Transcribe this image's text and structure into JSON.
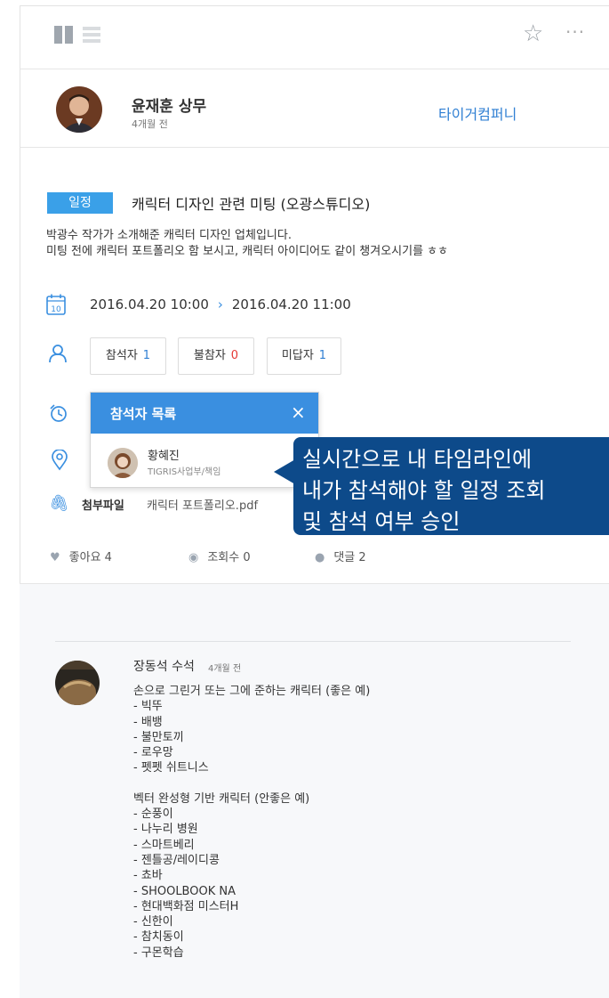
{
  "header": {
    "star_icon": "star-outline-icon",
    "more_icon": "more-horizontal-icon",
    "more_label": "···"
  },
  "author": {
    "name": "윤재훈 상무",
    "time": "4개월 전",
    "company": "타이거컴퍼니"
  },
  "event": {
    "badge": "일정",
    "title": "캐릭터 디자인 관련 미팅 (오광스튜디오)",
    "desc": [
      "박광수 작가가 소개해준 캐릭터 디자인 업체입니다.",
      "미팅 전에 캐릭터 포트폴리오 함 보시고, 캐릭터 아이디어도 같이 챙겨오시기를 ㅎㅎ"
    ],
    "calendar_day": "10",
    "start": "2016.04.20 10:00",
    "arrow": "›",
    "end": "2016.04.20 11:00"
  },
  "attendance": [
    {
      "label": "참석자",
      "count": "1",
      "color": "#2f7fd3"
    },
    {
      "label": "불참자",
      "count": "0",
      "color": "#e53935"
    },
    {
      "label": "미답자",
      "count": "1",
      "color": "#2f7fd3"
    }
  ],
  "popup": {
    "title": "참석자 목록",
    "close": "×",
    "person_name": "황혜진",
    "person_dept": "TIGRIS사업부/책임"
  },
  "callout": {
    "lines": [
      "실시간으로 내 타임라인에",
      "내가 참석해야 할 일정 조회",
      "및 참석 여부 승인"
    ]
  },
  "attachment": {
    "label": "첨부파일",
    "file": "캐릭터 포트폴리오.pdf"
  },
  "stats": {
    "likes": "좋아요 4",
    "views": "조회수 0",
    "comments": "댓글 2"
  },
  "comment": {
    "name": "장동석 수석",
    "time": "4개월 전",
    "block1": [
      "손으로 그린거 또는 그에 준하는 캐릭터 (좋은 예)",
      "- 빅뚜",
      "- 배뱅",
      "- 불만토끼",
      "- 로우망",
      "- 펫펫 쉬트니스"
    ],
    "block2": [
      "벡터 완성형 기반 캐릭터 (안좋은 예)",
      "- 순풍이",
      "- 나누리 병원",
      "- 스마트베리",
      "- 젠틀공/레이디콩",
      "- 쵸바",
      "- SHOOLBOOK NA",
      "- 현대백화점 미스터H",
      "- 신한이",
      "- 참치동이",
      "- 구몬학습"
    ]
  },
  "colors": {
    "accent": "#3a8fe0",
    "badge": "#3aa0e8",
    "callout": "#0d4a8a",
    "company": "#2f7fd3"
  }
}
